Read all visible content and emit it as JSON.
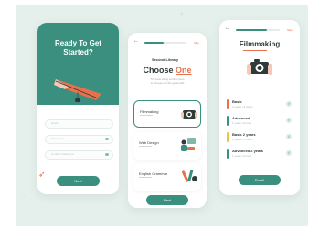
{
  "screen1": {
    "title_line1": "Ready To Get",
    "title_line2": "Started?",
    "fields": [
      {
        "placeholder": "Email"
      },
      {
        "placeholder": "Password"
      },
      {
        "placeholder": "Confirm Password"
      }
    ],
    "button_label": "Next"
  },
  "screen2": {
    "progress": 0.45,
    "skip_label": "Skip",
    "tagline": "Second Library",
    "heading_main": "Choose ",
    "heading_accent": "One",
    "subtitle_line1": "The best study environment",
    "subtitle_line2": "to choose not the great skill",
    "options": [
      {
        "label": "Filmmaking",
        "selected": true
      },
      {
        "label": "Web Design",
        "selected": false
      },
      {
        "label": "English Grammar",
        "selected": false
      }
    ],
    "button_label": "Next"
  },
  "screen3": {
    "progress": 0.7,
    "skip_label": "Skip",
    "heading": "Filmmaking",
    "lessons": [
      {
        "name": "Basic",
        "meta": "2 years • 6 hours",
        "color": "#e8714d"
      },
      {
        "name": "Advanced",
        "meta": "1 year • 4 hours",
        "color": "#3a8f7f"
      },
      {
        "name": "Basic 2 years",
        "meta": "2 years • 6 hours",
        "color": "#e8c24d"
      },
      {
        "name": "Advanced 2 years",
        "meta": "1 year • 4 hours",
        "color": "#3a8f7f"
      }
    ],
    "button_label": "Enroll"
  },
  "colors": {
    "brand": "#3a8f7f",
    "accent": "#e8714d",
    "background": "#e5efeb"
  }
}
